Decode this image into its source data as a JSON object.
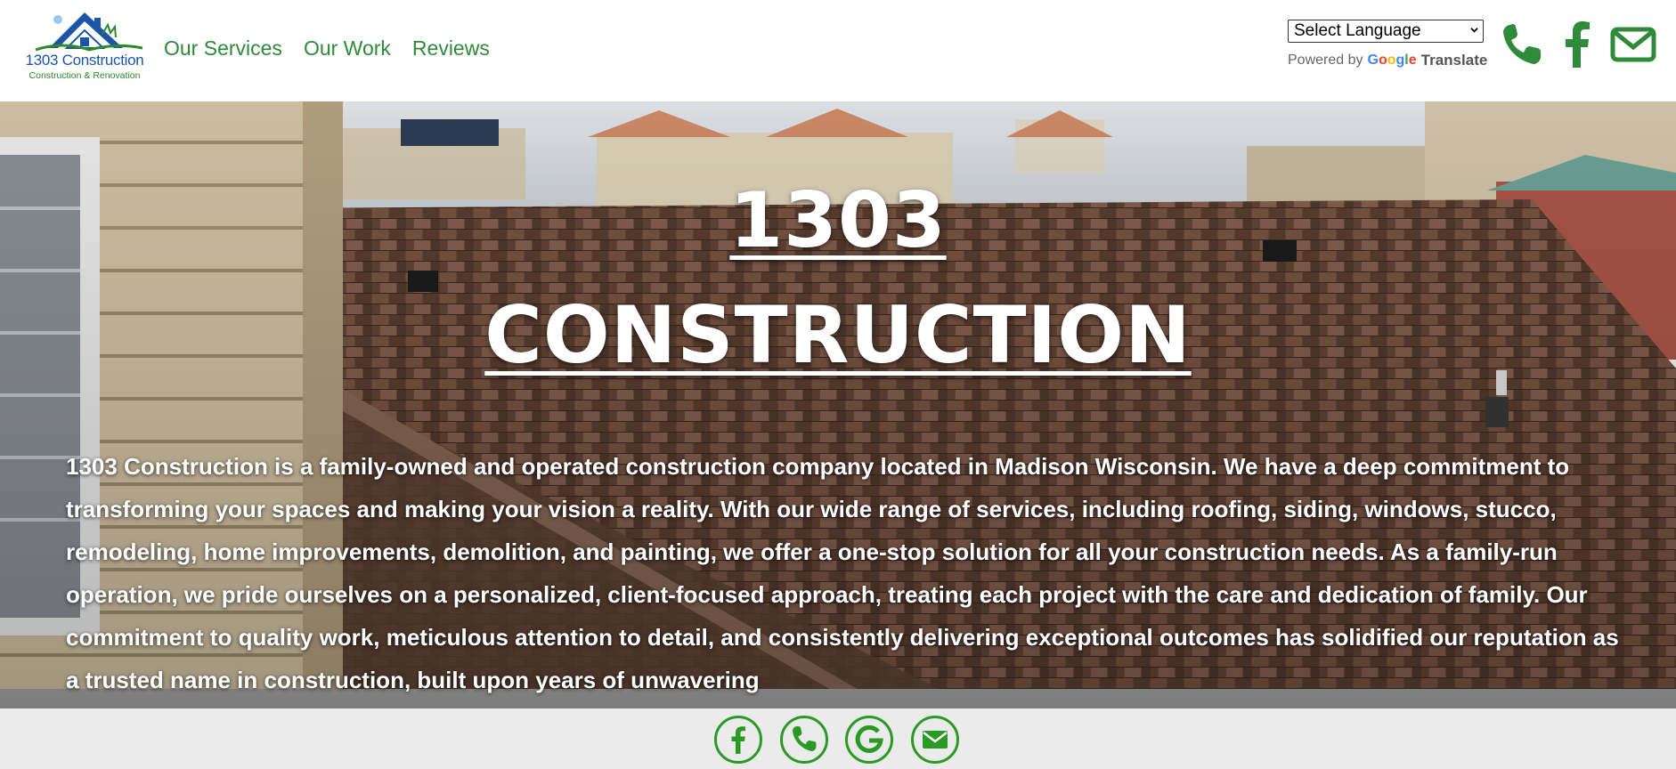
{
  "brand": {
    "name": "1303 Construction",
    "tagline": "Construction & Renovation",
    "colors": {
      "green": "#2f8a3a",
      "blue": "#1c55a6"
    }
  },
  "nav": {
    "items": [
      {
        "label": "Our Services"
      },
      {
        "label": "Our Work"
      },
      {
        "label": "Reviews"
      }
    ]
  },
  "translate": {
    "select_value": "Select Language",
    "powered_by": "Powered by",
    "google": "Google",
    "translate_label": "Translate"
  },
  "header_icons": [
    "phone-icon",
    "facebook-icon",
    "mail-icon"
  ],
  "hero": {
    "title_line1": "1303",
    "title_line2": "CONSTRUCTION",
    "body": "1303 Construction is a family-owned and operated construction company located in Madison Wisconsin. We have a deep commitment to transforming your spaces and making your vision a reality. With our wide range of services, including roofing, siding, windows, stucco, remodeling, home improvements, demolition, and painting, we offer a one-stop solution for all your construction needs. As a family-run operation, we pride ourselves on a personalized, client-focused approach, treating each project with the care and dedication of family. Our commitment to quality work, meticulous attention to detail, and consistently delivering exceptional outcomes has solidified our reputation as a trusted name in construction, built upon years of unwavering"
  },
  "footer_icons": [
    "facebook-icon",
    "phone-icon",
    "google-icon",
    "mail-icon"
  ]
}
